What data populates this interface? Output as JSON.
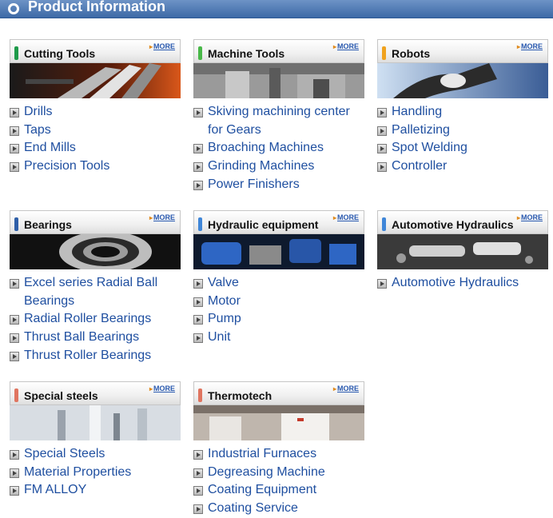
{
  "header": {
    "title": "Product Information"
  },
  "more_label": "MORE",
  "categories": [
    {
      "name": "Cutting Tools",
      "accent": "#1e9a4a",
      "items": [
        "Drills",
        "Taps",
        "End Mills",
        "Precision Tools"
      ]
    },
    {
      "name": "Machine Tools",
      "accent": "#48b848",
      "items": [
        "Skiving machining center",
        "for Gears",
        "Broaching Machines",
        "Grinding Machines",
        "Power Finishers"
      ]
    },
    {
      "name": "Robots",
      "accent": "#f0a21e",
      "items": [
        "Handling",
        "Palletizing",
        "Spot Welding",
        "Controller"
      ]
    },
    {
      "name": "Bearings",
      "accent": "#2f5fa8",
      "items": [
        "Excel series Radial Ball",
        "Bearings",
        "Radial Roller Bearings",
        "Thrust Ball Bearings",
        "Thrust Roller Bearings"
      ]
    },
    {
      "name": "Hydraulic equipment",
      "accent": "#3f86d8",
      "items": [
        "Valve",
        "Motor",
        "Pump",
        "Unit"
      ]
    },
    {
      "name": "Automotive Hydraulics",
      "accent": "#3f86d8",
      "items": [
        "Automotive Hydraulics"
      ]
    },
    {
      "name": "Special steels",
      "accent": "#e07560",
      "items": [
        "Special Steels",
        "Material Properties",
        "FM ALLOY"
      ]
    },
    {
      "name": "Thermotech",
      "accent": "#e07560",
      "items": [
        "Industrial Furnaces",
        "Degreasing Machine",
        "Coating Equipment",
        "Coating Service"
      ]
    }
  ]
}
